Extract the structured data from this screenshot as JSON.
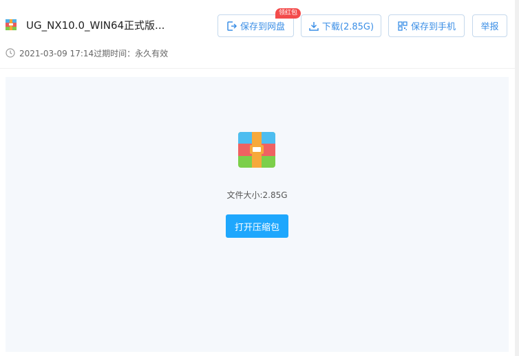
{
  "file": {
    "name": "UG_NX10.0_WIN64正式版....",
    "icon": "archive-icon",
    "size_text": "文件大小:2.85G"
  },
  "meta": {
    "text": "2021-03-09 17:14过期时间：永久有效"
  },
  "toolbar": {
    "save_to_cloud": "保存到网盘",
    "badge": "领红包",
    "download": "下载(2.85G)",
    "save_to_phone": "保存到手机",
    "report": "举报"
  },
  "content": {
    "open_button": "打开压缩包"
  },
  "colors": {
    "accent": "#3a8ee6",
    "primary_button": "#1ea7fd",
    "badge": "#f34b4b",
    "content_bg": "#f5f8fc"
  }
}
